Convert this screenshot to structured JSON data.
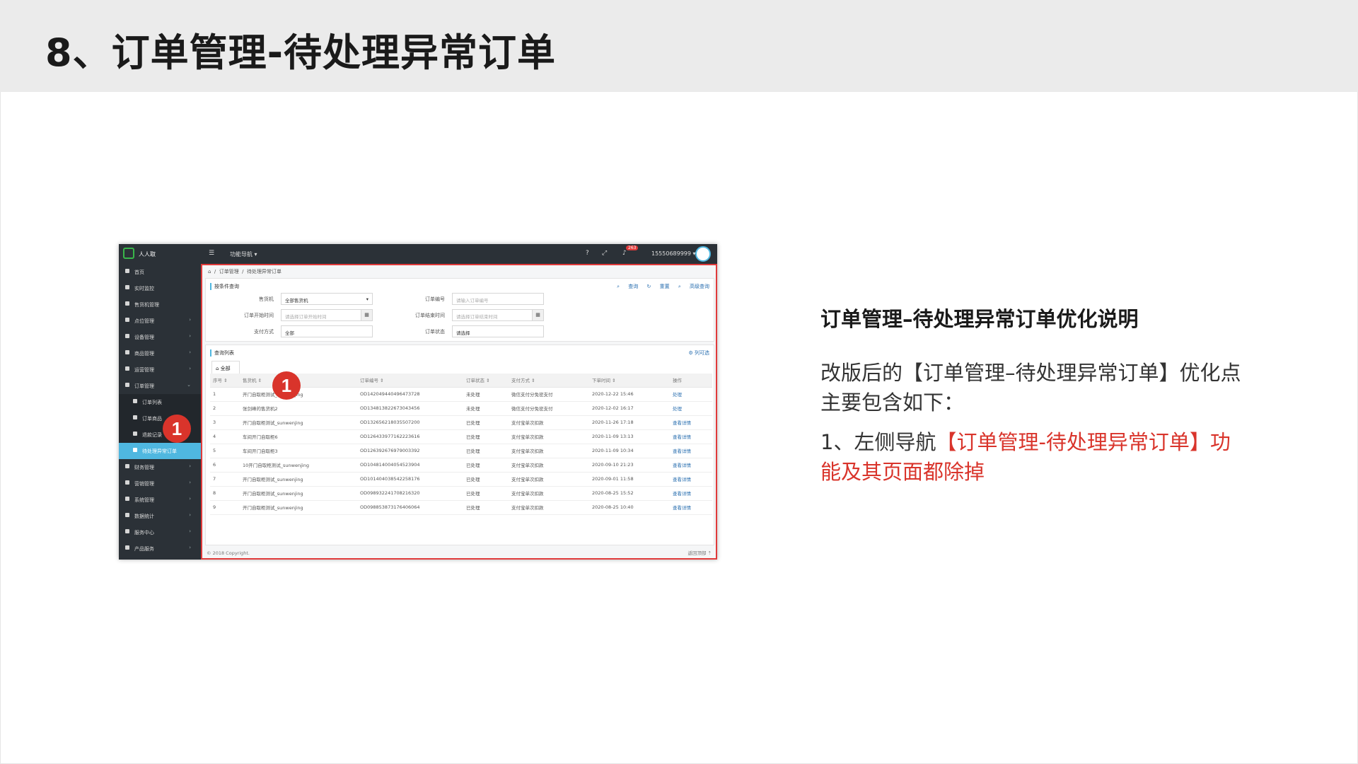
{
  "slide": {
    "title": "8、订单管理-待处理异常订单"
  },
  "app": {
    "brand": "人人取",
    "function_nav": "功能导航 ▾",
    "help": "?",
    "notification_count": "263",
    "user": "15550689999 ▾"
  },
  "sidebar": {
    "items": [
      {
        "label": "首页",
        "arrow": ""
      },
      {
        "label": "实时监控",
        "arrow": ""
      },
      {
        "label": "售货机管理",
        "arrow": ""
      },
      {
        "label": "点位管理",
        "arrow": "›"
      },
      {
        "label": "设备管理",
        "arrow": "›"
      },
      {
        "label": "商品管理",
        "arrow": "›"
      },
      {
        "label": "运营管理",
        "arrow": "›"
      },
      {
        "label": "订单管理",
        "arrow": "⌄"
      },
      {
        "label": "订单列表",
        "arrow": ""
      },
      {
        "label": "订单商品",
        "arrow": ""
      },
      {
        "label": "退款记录",
        "arrow": ""
      },
      {
        "label": "待处理异常订单",
        "arrow": ""
      },
      {
        "label": "财务管理",
        "arrow": "›"
      },
      {
        "label": "营销管理",
        "arrow": "›"
      },
      {
        "label": "系统管理",
        "arrow": "›"
      },
      {
        "label": "数据统计",
        "arrow": "›"
      },
      {
        "label": "服务中心",
        "arrow": "›"
      },
      {
        "label": "产品服务",
        "arrow": "›"
      }
    ]
  },
  "breadcrumb": {
    "level1": "订单管理",
    "level2": "待处理异常订单"
  },
  "query": {
    "title": "按条件查询",
    "search": "查询",
    "reset": "重置",
    "advanced": "高级查询",
    "fields": {
      "machine_label": "售货机",
      "machine_value": "全部售货机",
      "order_no_label": "订单编号",
      "order_no_placeholder": "请输入订单编号",
      "start_label": "订单开始时间",
      "start_placeholder": "请选择订单开始时间",
      "end_label": "订单结束时间",
      "end_placeholder": "请选择订单结束时间",
      "pay_label": "支付方式",
      "pay_value": "全部",
      "status_label": "订单状态",
      "status_value": "请选择"
    }
  },
  "list": {
    "title": "查询列表",
    "column_filter": "列可选",
    "tab_all": "全部",
    "headers": [
      "序号 ⇕",
      "售货机 ⇕",
      "订单编号 ⇕",
      "订单状态 ⇕",
      "支付方式 ⇕",
      "下单时间 ⇕",
      "操作"
    ],
    "rows": [
      [
        "1",
        "开门自取柜测试_sunwenjing",
        "OD142049440496473728",
        "未处理",
        "微信支付分免密支付",
        "2020-12-22 15:46",
        "处理"
      ],
      [
        "2",
        "张剑峰的售货机2",
        "OD134813822673043456",
        "未处理",
        "微信支付分免密支付",
        "2020-12-02 16:17",
        "处理"
      ],
      [
        "3",
        "开门自取柜测试_sunwenjing",
        "OD132656218035507200",
        "已处理",
        "支付宝单次扣款",
        "2020-11-26 17:18",
        "查看详情"
      ],
      [
        "4",
        "车间开门自取柜6",
        "OD126433977162223616",
        "已处理",
        "支付宝单次扣款",
        "2020-11-09 13:13",
        "查看详情"
      ],
      [
        "5",
        "车间开门自取柜3",
        "OD126392676979003392",
        "已处理",
        "支付宝单次扣款",
        "2020-11-09 10:34",
        "查看详情"
      ],
      [
        "6",
        "10开门自取柜测试_sunwenjing",
        "OD104814004054523904",
        "已处理",
        "支付宝单次扣款",
        "2020-09-10 21:23",
        "查看详情"
      ],
      [
        "7",
        "开门自取柜测试_sunwenjing",
        "OD101404038542258176",
        "已处理",
        "支付宝单次扣款",
        "2020-09-01 11:58",
        "查看详情"
      ],
      [
        "8",
        "开门自取柜测试_sunwenjing",
        "OD098932241708216320",
        "已处理",
        "支付宝单次扣款",
        "2020-08-25 15:52",
        "查看详情"
      ],
      [
        "9",
        "开门自取柜测试_sunwenjing",
        "OD098853873176406064",
        "已处理",
        "支付宝单次扣款",
        "2020-08-25 10:40",
        "查看详情"
      ]
    ]
  },
  "footer": {
    "copyright": "© 2018 Copyright.",
    "back_top": "返回顶部 ⇡"
  },
  "markers": {
    "sidebar": "1",
    "tab": "1"
  },
  "explanation": {
    "title": "订单管理–待处理异常订单优化说明",
    "intro": "改版后的【订单管理–待处理异常订单】优化点主要包含如下：",
    "item_prefix": "1、左侧导航",
    "item_highlight": "【订单管理-待处理异常订单】功能及其页面都除掉"
  },
  "colors": {
    "highlight_red": "#d9342b",
    "sidebar_active": "#4fb7e0",
    "header_bg": "#ebebeb"
  }
}
